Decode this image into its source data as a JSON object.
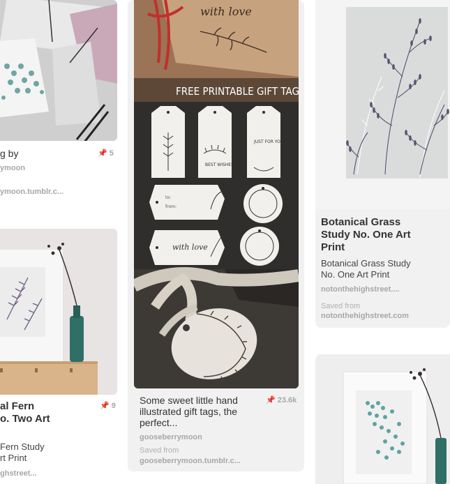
{
  "col1": {
    "pin_a": {
      "title": "g by",
      "pinner": "ymoon",
      "source": "ymoon.tumblr.c...",
      "repins": "5"
    },
    "pin_b": {
      "title_line1": "al Fern",
      "title_line2": "o. Two Art",
      "desc_line1": "Fern Study",
      "desc_line2": "rt Print",
      "source": "ghstreet...",
      "repins": "9"
    }
  },
  "col2": {
    "pin": {
      "overlay_heading": "FREE PRINTABLE GIFT TAGS",
      "tag_text_love": "with love",
      "tag_text_wishes": "BEST WISHES",
      "tag_text_just": "JUST FOR YOU",
      "tag_to": "to:",
      "tag_from": "from:",
      "tag_text_love2": "with love",
      "desc_line1": "Some sweet little hand",
      "desc_line2": "illustrated gift tags, the",
      "desc_line3": "perfect...",
      "repins": "23.6k",
      "pinner": "gooseberrymoon",
      "saved_from_label": "Saved from",
      "source": "gooseberrymoon.tumblr.c..."
    }
  },
  "col3": {
    "pin_a": {
      "title_line1": "Botanical Grass",
      "title_line2": "Study No. One Art",
      "title_line3": "Print",
      "desc_line1": "Botanical Grass Study",
      "desc_line2": "No. One Art Print",
      "pinner": "notonthehighstreet....",
      "saved_from_label": "Saved from",
      "source": "notonthehighstreet.com"
    }
  },
  "icons": {
    "repin": "pushpin-icon"
  },
  "colors": {
    "card_bg": "#f1f1f1",
    "title_text": "#333333",
    "meta_text": "#a7a7a7"
  }
}
